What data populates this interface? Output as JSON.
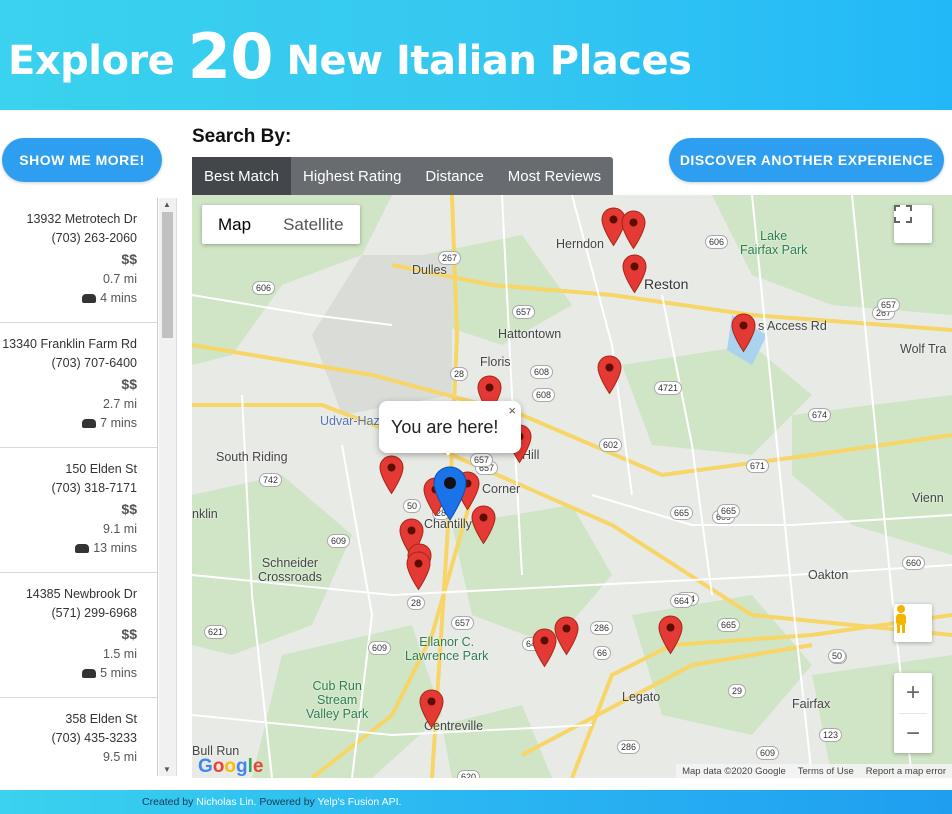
{
  "header": {
    "prefix": "Explore",
    "count": "20",
    "suffix": "New Italian Places"
  },
  "buttons": {
    "show_more": "SHOW ME MORE!",
    "discover": "DISCOVER ANOTHER EXPERIENCE"
  },
  "search": {
    "label": "Search By:",
    "tabs": [
      "Best Match",
      "Highest Rating",
      "Distance",
      "Most Reviews"
    ],
    "active_tab": "Best Match"
  },
  "results": [
    {
      "address": "13932 Metrotech Dr",
      "phone": "(703) 263-2060",
      "price": "$$",
      "distance": "0.7 mi",
      "drive_time": "4 mins"
    },
    {
      "address": "13340 Franklin Farm Rd",
      "phone": "(703) 707-6400",
      "price": "$$",
      "distance": "2.7 mi",
      "drive_time": "7 mins"
    },
    {
      "address": "150 Elden St",
      "phone": "(703) 318-7171",
      "price": "$$",
      "distance": "9.1 mi",
      "drive_time": "13 mins"
    },
    {
      "address": "14385 Newbrook Dr",
      "phone": "(571) 299-6968",
      "price": "$$",
      "distance": "1.5 mi",
      "drive_time": "5 mins"
    },
    {
      "address": "358 Elden St",
      "phone": "(703) 435-3233",
      "price": "",
      "distance": "9.5 mi",
      "drive_time": ""
    }
  ],
  "map": {
    "type_options": [
      "Map",
      "Satellite"
    ],
    "active_type": "Map",
    "popup_text": "You are here!",
    "popup_close": "×",
    "labels": {
      "herndon": "Herndon",
      "reston": "Reston",
      "lake_fairfax": "Lake\nFairfax Park",
      "dulles": "Dulles",
      "hattontown": "Hattontown",
      "floris": "Floris",
      "udvar": "Udvar-Haz",
      "south_riding": "South Riding",
      "chantilly": "Chantilly",
      "corner": "Corner",
      "hill": "Hill",
      "schneider": "Schneider\nCrossroads",
      "oakton": "Oakton",
      "ellanor": "Ellanor C.\nLawrence Park",
      "cub_run": "Cub Run\nStream\nValley Park",
      "legato": "Legato",
      "centreville": "Centreville",
      "fairfax": "Fairfax",
      "bull_run": "Bull Run",
      "wolf_tra": "Wolf Tra",
      "vienna": "Vienn",
      "access_rd": "s Access Rd",
      "franklin": "nklin"
    },
    "shields": [
      "606",
      "267",
      "606",
      "28",
      "657",
      "267",
      "657",
      "608",
      "608",
      "4721",
      "28",
      "657",
      "602",
      "674",
      "742",
      "50",
      "28",
      "657",
      "609",
      "671",
      "665",
      "609",
      "665",
      "50",
      "660",
      "674",
      "28",
      "657",
      "621",
      "664",
      "665",
      "609",
      "645",
      "286",
      "50",
      "66",
      "29",
      "609",
      "286",
      "123",
      "620"
    ],
    "google": "Google",
    "attribution": [
      "Map data ©2020 Google",
      "Terms of Use",
      "Report a map error"
    ],
    "zoom_in": "+",
    "zoom_out": "−"
  },
  "footer": {
    "created_by": "Created by",
    "author": "Nicholas Lin.",
    "powered_by": "Powered by",
    "api": "Yelp's Fusion API."
  },
  "colors": {
    "accent": "#2e9ef0",
    "marker_red": "#e53935",
    "marker_blue": "#1a73e8"
  }
}
